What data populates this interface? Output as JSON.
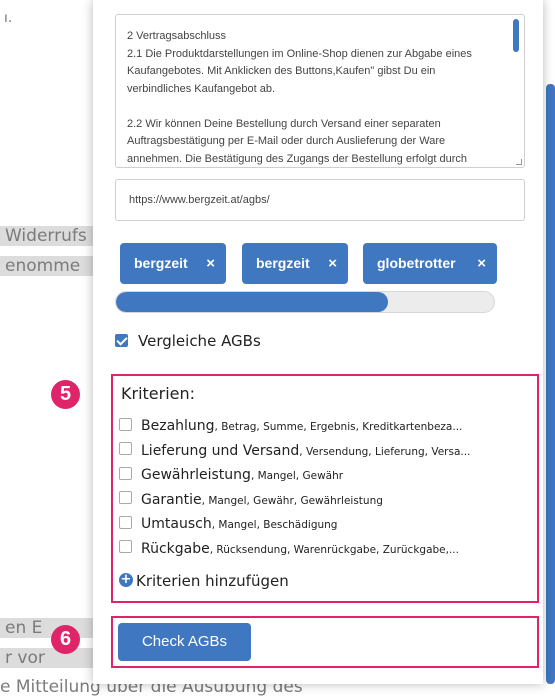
{
  "background": {
    "line1": "ו.",
    "line2": "Widerrufs",
    "line3": "enomme",
    "line4": "en E",
    "line5": "r vor",
    "line6": "e Mitteilung über die Ausübung des"
  },
  "terms_text": "2 Vertragsabschluss\n2.1 Die Produktdarstellungen im Online-Shop dienen zur Abgabe eines Kaufangebotes. Mit Anklicken des Buttons,Kaufen\" gibst Du ein verbindliches Kaufangebot ab.\n\n2.2 Wir können Deine Bestellung durch Versand einer separaten Auftragsbestätigung per E-Mail oder durch Auslieferung der Ware annehmen. Die Bestätigung des Zugangs der Bestellung erfolgt durch automatisierte E-Mail unmittelbar nach dem",
  "url_value": "https://www.bergzeit.at/agbs/",
  "tags": [
    {
      "label": "bergzeit",
      "remove": "×"
    },
    {
      "label": "bergzeit",
      "remove": "×"
    },
    {
      "label": "globetrotter",
      "remove": "×"
    }
  ],
  "progress": 0.72,
  "compare": {
    "label": "Vergleiche AGBs",
    "checked": true
  },
  "criteria": {
    "title": "Kriterien:",
    "items": [
      {
        "name": "Bezahlung",
        "synonyms": ", Betrag, Summe, Ergebnis, Kreditkartenbeza..."
      },
      {
        "name": "Lieferung und Versand",
        "synonyms": ", Versendung, Lieferung, Versa..."
      },
      {
        "name": "Gewährleistung",
        "synonyms": ", Mangel, Gewähr"
      },
      {
        "name": "Garantie",
        "synonyms": ", Mangel, Gewähr, Gewährleistung"
      },
      {
        "name": "Umtausch",
        "synonyms": ", Mangel, Beschädigung"
      },
      {
        "name": "Rückgabe",
        "synonyms": ", Rücksendung, Warenrückgabe, Zurückgabe,..."
      }
    ],
    "add_label": "Kriterien hinzufügen",
    "add_icon": "plus-circle-icon"
  },
  "check_button": "Check AGBs",
  "steps": {
    "criteria": "5",
    "check": "6"
  },
  "colors": {
    "accent": "#3f77c1",
    "highlight": "#e0246a"
  }
}
